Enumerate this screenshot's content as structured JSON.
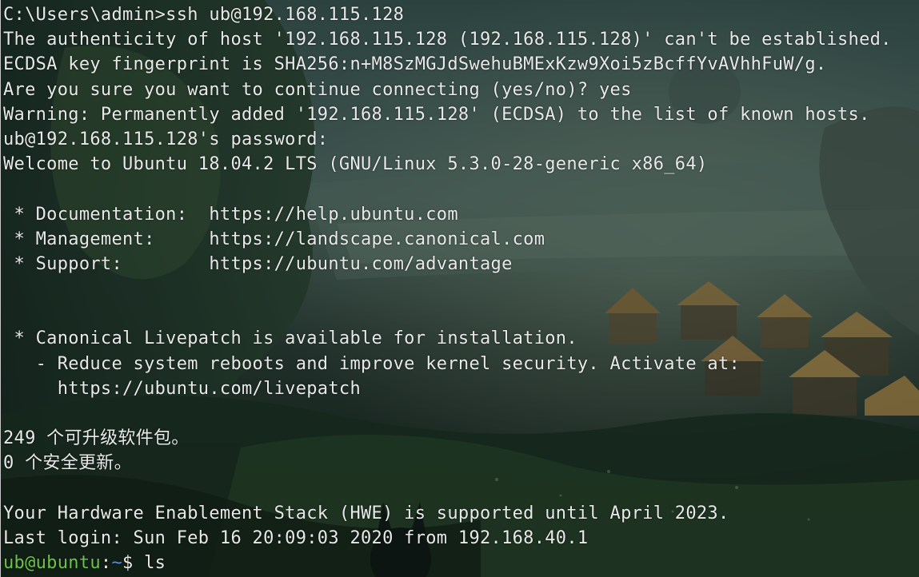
{
  "terminal": {
    "lines": [
      "C:\\Users\\admin>ssh ub@192.168.115.128",
      "The authenticity of host '192.168.115.128 (192.168.115.128)' can't be established.",
      "ECDSA key fingerprint is SHA256:n+M8SzMGJdSwehuBMExKzw9Xoi5zBcffYvAVhhFuW/g.",
      "Are you sure you want to continue connecting (yes/no)? yes",
      "Warning: Permanently added '192.168.115.128' (ECDSA) to the list of known hosts.",
      "ub@192.168.115.128's password:",
      "Welcome to Ubuntu 18.04.2 LTS (GNU/Linux 5.3.0-28-generic x86_64)",
      "",
      " * Documentation:  https://help.ubuntu.com",
      " * Management:     https://landscape.canonical.com",
      " * Support:        https://ubuntu.com/advantage",
      "",
      "",
      " * Canonical Livepatch is available for installation.",
      "   - Reduce system reboots and improve kernel security. Activate at:",
      "     https://ubuntu.com/livepatch",
      "",
      "249 个可升级软件包。",
      "0 个安全更新。",
      "",
      "Your Hardware Enablement Stack (HWE) is supported until April 2023.",
      "Last login: Sun Feb 16 20:09:03 2020 from 192.168.40.1"
    ],
    "prompt": {
      "user_host": "ub@ubuntu",
      "separator": ":",
      "path": "~",
      "symbol": "$ ",
      "command": "ls"
    }
  },
  "colors": {
    "text": "#e8e8e8",
    "prompt_user": "#6cc24a",
    "prompt_path": "#5a8fe0"
  }
}
